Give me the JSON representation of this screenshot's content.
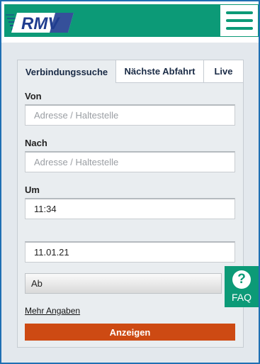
{
  "header": {
    "logo_text": "RMV",
    "menu_icon": "hamburger-menu-icon"
  },
  "tabs": [
    {
      "label": "Verbindungssuche",
      "active": true
    },
    {
      "label": "Nächste Abfahrt",
      "active": false
    },
    {
      "label": "Live",
      "active": false
    }
  ],
  "form": {
    "from_label": "Von",
    "from_placeholder": "Adresse / Haltestelle",
    "to_label": "Nach",
    "to_placeholder": "Adresse / Haltestelle",
    "time_label": "Um",
    "time_value": "11:34",
    "date_value": "11.01.21",
    "mode_value": "Ab",
    "more_link": "Mehr Angaben",
    "submit_label": "Anzeigen"
  },
  "faq": {
    "label": "FAQ",
    "icon": "question-icon"
  },
  "colors": {
    "brand": "#0c9a77",
    "submit": "#cd4a13",
    "frame": "#1f6fb3"
  }
}
